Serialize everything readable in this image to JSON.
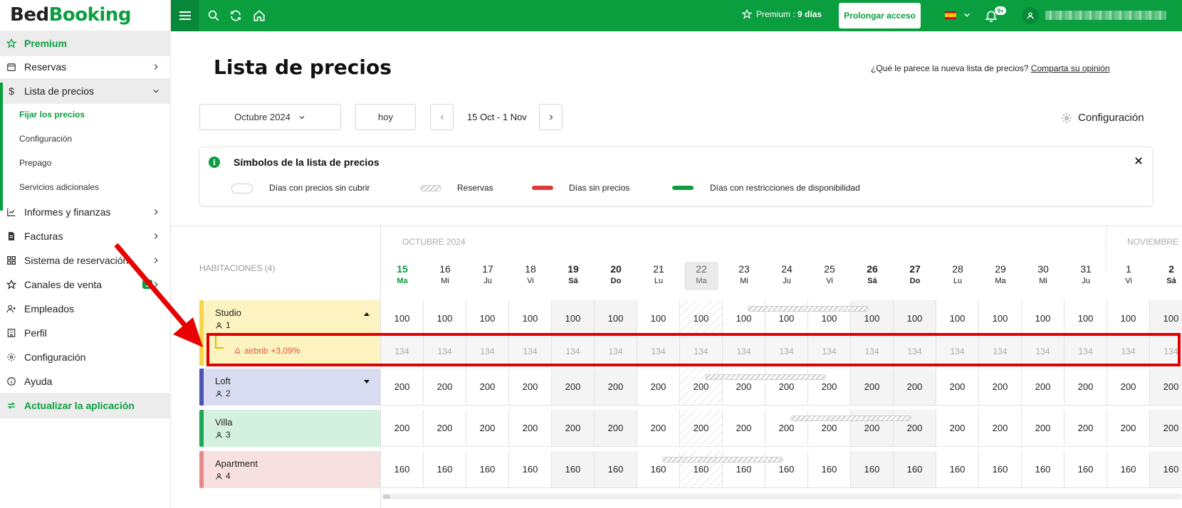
{
  "logo": {
    "part1": "Bed",
    "part2": "Booking"
  },
  "sidebar": {
    "items": [
      {
        "label": "Premium"
      },
      {
        "label": "Reservas"
      },
      {
        "label": "Lista de precios"
      },
      {
        "label": "Informes y finanzas"
      },
      {
        "label": "Facturas"
      },
      {
        "label": "Sistema de reservación"
      },
      {
        "label": "Canales de venta",
        "badge": "3"
      },
      {
        "label": "Empleados"
      },
      {
        "label": "Perfil"
      },
      {
        "label": "Configuración"
      },
      {
        "label": "Ayuda"
      },
      {
        "label": "Actualizar la aplicación"
      }
    ],
    "subitems": [
      {
        "label": "Fijar los precios"
      },
      {
        "label": "Configuración"
      },
      {
        "label": "Prepago"
      },
      {
        "label": "Servicios adicionales"
      }
    ]
  },
  "topbar": {
    "premium_label": "Premium : ",
    "premium_days": "9 días",
    "prolong_button": "Prolongar acceso",
    "notif_badge": "9+",
    "language": "es",
    "accent_color": "#0a9e3f"
  },
  "page": {
    "title": "Lista de precios",
    "feedback_question": "¿Qué le parece la nueva lista de precios? ",
    "feedback_link": "Comparta su opinión",
    "month_select": "Octubre 2024",
    "today_button": "hoy",
    "date_range": "15 Oct - 1 Nov",
    "config_button": "Configuración"
  },
  "legend": {
    "title": "Símbolos de la lista de precios",
    "items": [
      {
        "label": "Días con precios sin cubrir",
        "color": "#ffffff"
      },
      {
        "label": "Reservas",
        "color": "#d8d8d8"
      },
      {
        "label": "Días sin precios",
        "color": "#e03a3a"
      },
      {
        "label": "Días con restricciones de disponibilidad",
        "color": "#0a9e3f"
      }
    ]
  },
  "grid": {
    "rooms_header": "HABITACIONES (4)",
    "month_oct": "OCTUBRE 2024",
    "month_nov": "NOVIEMBRE",
    "days": [
      {
        "d": "15",
        "w": "Ma"
      },
      {
        "d": "16",
        "w": "Mi"
      },
      {
        "d": "17",
        "w": "Ju"
      },
      {
        "d": "18",
        "w": "Vi"
      },
      {
        "d": "19",
        "w": "Sá"
      },
      {
        "d": "20",
        "w": "Do"
      },
      {
        "d": "21",
        "w": "Lu"
      },
      {
        "d": "22",
        "w": "Ma"
      },
      {
        "d": "23",
        "w": "Mi"
      },
      {
        "d": "24",
        "w": "Ju"
      },
      {
        "d": "25",
        "w": "Vi"
      },
      {
        "d": "26",
        "w": "Sá"
      },
      {
        "d": "27",
        "w": "Do"
      },
      {
        "d": "28",
        "w": "Lu"
      },
      {
        "d": "29",
        "w": "Ma"
      },
      {
        "d": "30",
        "w": "Mi"
      },
      {
        "d": "31",
        "w": "Ju"
      },
      {
        "d": "1",
        "w": "Vi"
      },
      {
        "d": "2",
        "w": "Sá"
      }
    ],
    "rooms": [
      {
        "name": "Studio",
        "capacity": "1",
        "color": "#fdf3c0",
        "border": "#f6d648",
        "price": "100",
        "expanded": true
      },
      {
        "name": "Loft",
        "capacity": "2",
        "color": "#d9dcf0",
        "border": "#4a55b5",
        "price": "200",
        "expanded": false
      },
      {
        "name": "Villa",
        "capacity": "3",
        "color": "#d4f0df",
        "border": "#1fa855",
        "price": "200",
        "expanded": false
      },
      {
        "name": "Apartment",
        "capacity": "4",
        "color": "#f7e0e0",
        "border": "#e88a8a",
        "price": "160",
        "expanded": false
      }
    ],
    "channel": {
      "name": "airbnb",
      "markup": "+3,09%",
      "price": "134",
      "color": "#e0533d"
    }
  }
}
